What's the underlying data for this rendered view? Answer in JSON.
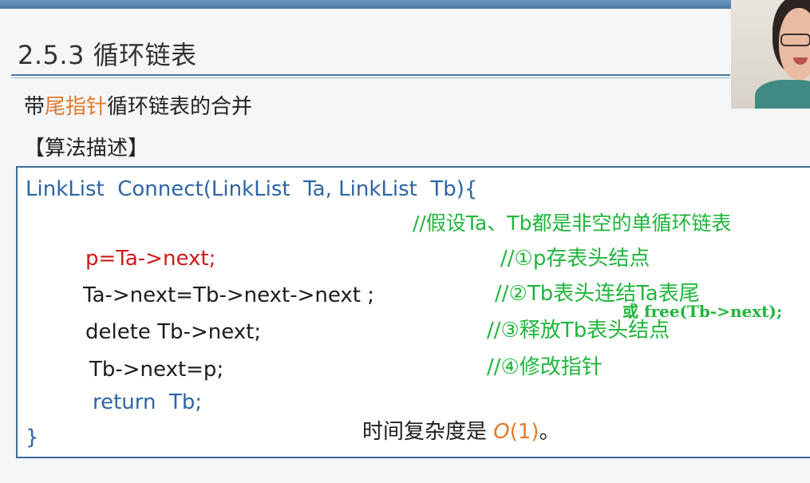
{
  "slide": {
    "section_title": "2.5.3 循环链表",
    "subtitle_pre": "带",
    "subtitle_accent": "尾指针",
    "subtitle_post": "循环链表的合并",
    "algo_label": "【算法描述】"
  },
  "code": {
    "signature": "LinkList  Connect(LinkList  Ta, LinkList  Tb){",
    "assumption_comment": "//假设Ta、Tb都是非空的单循环链表",
    "line1": "p=Ta->next;",
    "line1_comment": "//①p存表头结点",
    "line2": "Ta->next=Tb->next->next ;",
    "line2_comment": "//②Tb表头连结Ta表尾",
    "line2_alt": "或 free(Tb->next);",
    "line3": "delete Tb->next;",
    "line3_comment": "//③释放Tb表头结点",
    "line4": "Tb->next=p;",
    "line4_comment": "//④修改指针",
    "line5": "return  Tb;",
    "closing": "}",
    "complexity_label": "时间复杂度是 ",
    "complexity_o": "O",
    "complexity_n": "(1)",
    "complexity_end": "。"
  },
  "colors": {
    "accent": "#e27a2c",
    "keyword_blue": "#2e64a6",
    "comment_green": "#1fb53b",
    "highlight_red": "#d01818",
    "border": "#3f6c93"
  }
}
